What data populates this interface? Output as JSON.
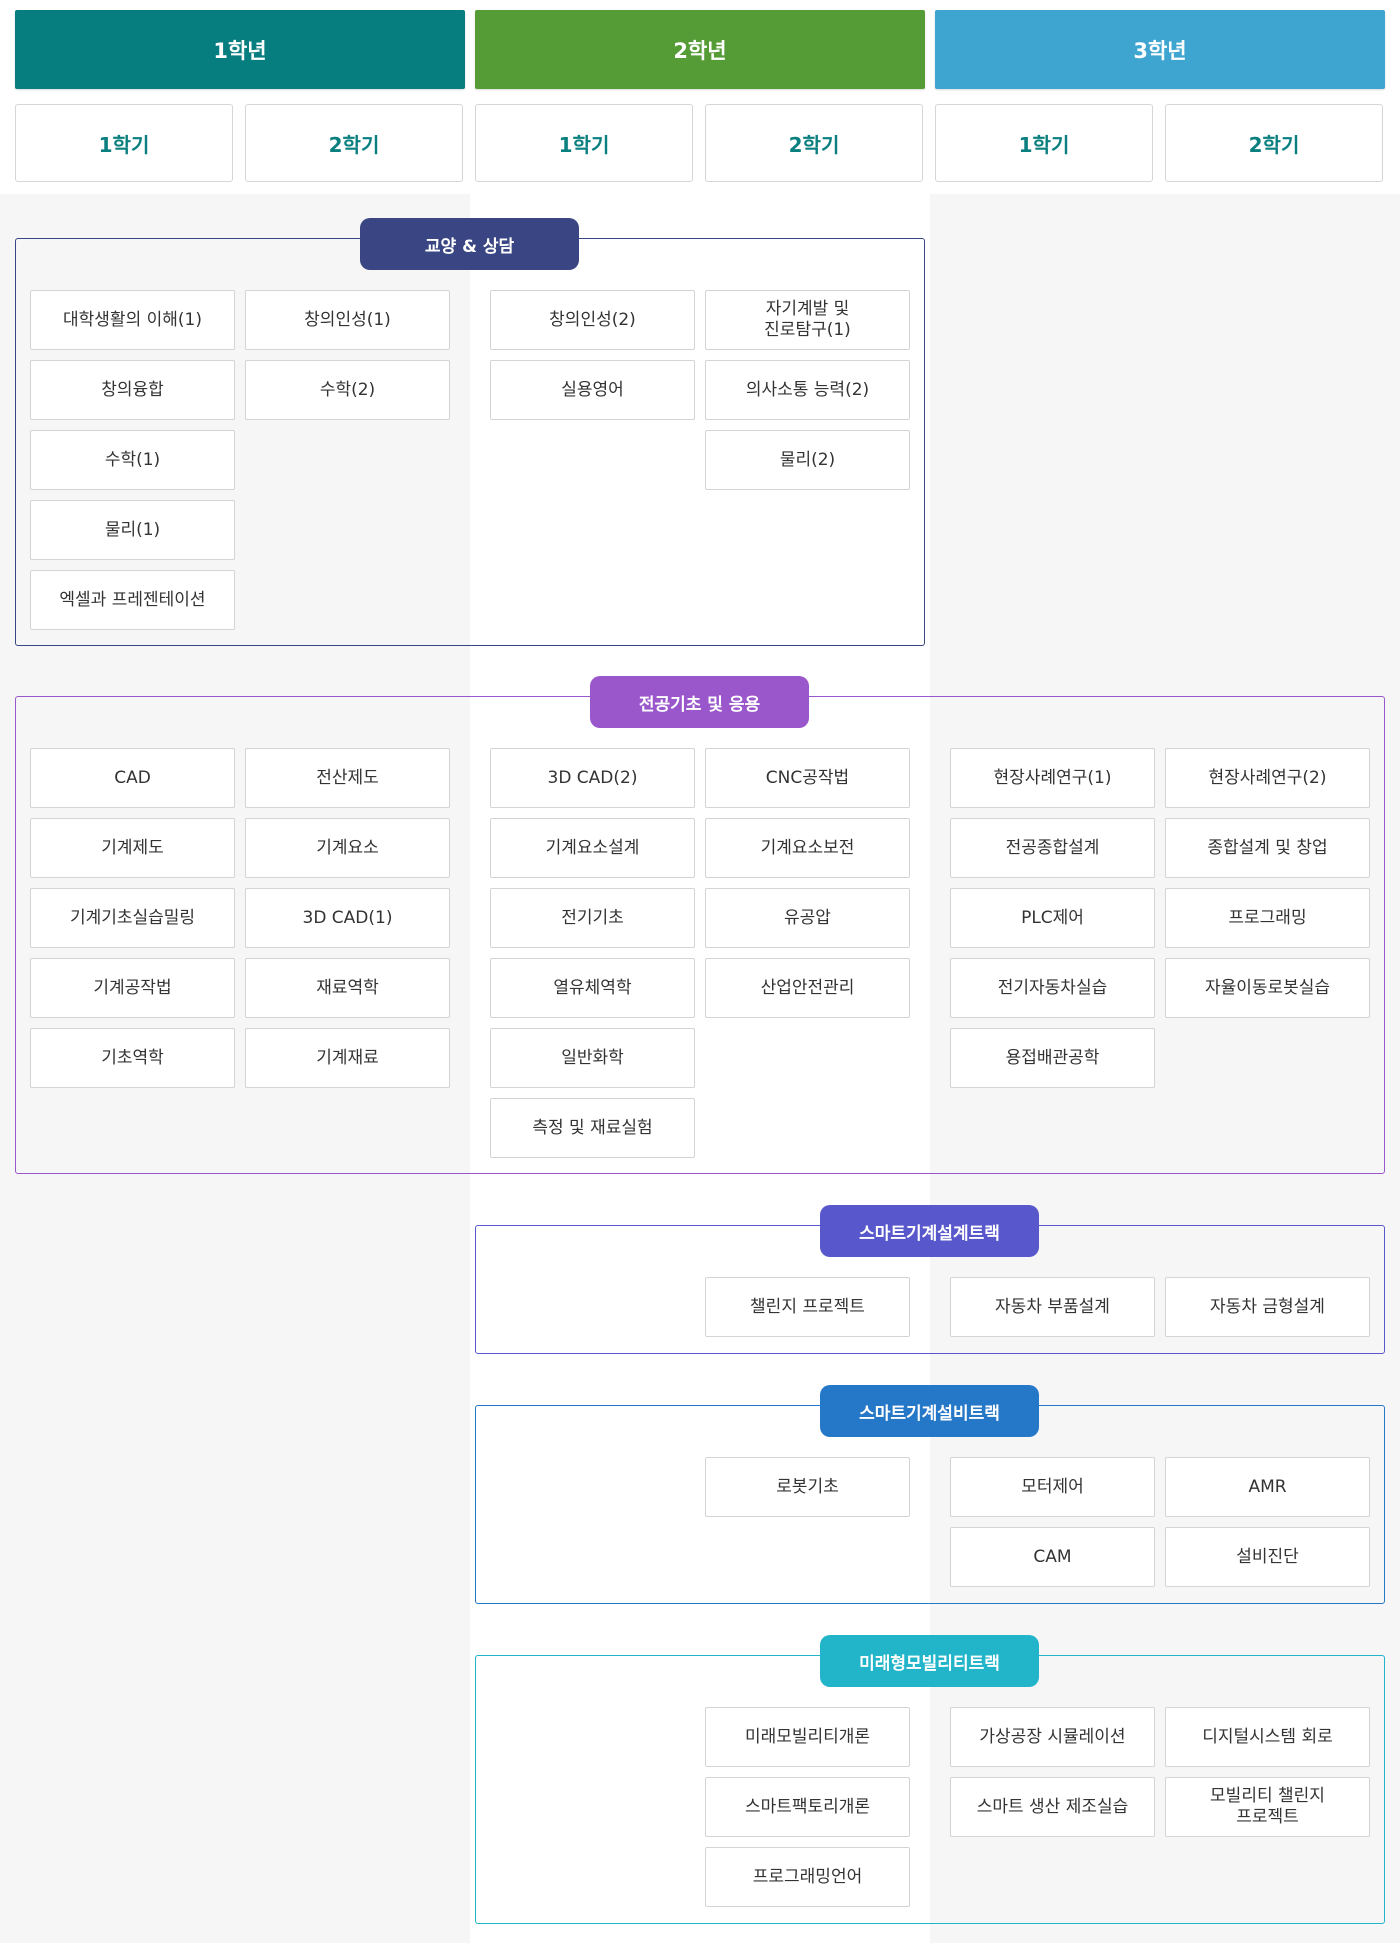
{
  "colors": {
    "year1": "#067e80",
    "year2": "#559c36",
    "year3": "#3ea5d0",
    "semester_text": "#0a7f80",
    "general": "#3a4683",
    "major": "#9a57cc",
    "design_track": "#5957cc",
    "equipment_track": "#2578c8",
    "mobility_track": "#22b4c9"
  },
  "years": [
    "1학년",
    "2학년",
    "3학년"
  ],
  "semesters": [
    "1학기",
    "2학기",
    "1학기",
    "2학기",
    "1학기",
    "2학기"
  ],
  "sections": {
    "general": {
      "title": "교양 & 상담",
      "courses": {
        "y1s1": [
          "대학생활의 이해(1)",
          "창의융합",
          "수학(1)",
          "물리(1)",
          "엑셀과 프레젠테이션"
        ],
        "y1s2": [
          "창의인성(1)",
          "수학(2)"
        ],
        "y2s1": [
          "창의인성(2)",
          "실용영어"
        ],
        "y2s2": [
          "자기계발 및\n진로탐구(1)",
          "의사소통 능력(2)",
          "물리(2)"
        ]
      }
    },
    "major": {
      "title": "전공기초 및 응용",
      "courses": {
        "y1s1": [
          "CAD",
          "기계제도",
          "기계기초실습밀링",
          "기계공작법",
          "기초역학"
        ],
        "y1s2": [
          "전산제도",
          "기계요소",
          "3D CAD(1)",
          "재료역학",
          "기계재료"
        ],
        "y2s1": [
          "3D CAD(2)",
          "기계요소설계",
          "전기기초",
          "열유체역학",
          "일반화학",
          "측정 및 재료실험"
        ],
        "y2s2": [
          "CNC공작법",
          "기계요소보전",
          "유공압",
          "산업안전관리"
        ],
        "y3s1": [
          "현장사례연구(1)",
          "전공종합설계",
          "PLC제어",
          "전기자동차실습",
          "용접배관공학"
        ],
        "y3s2": [
          "현장사례연구(2)",
          "종합설계 및 창업",
          "프로그래밍",
          "자율이동로봇실습"
        ]
      }
    },
    "design_track": {
      "title": "스마트기계설계트랙",
      "courses": {
        "y2s2": [
          "챌린지 프로젝트"
        ],
        "y3s1": [
          "자동차 부품설계"
        ],
        "y3s2": [
          "자동차 금형설계"
        ]
      }
    },
    "equipment_track": {
      "title": "스마트기계설비트랙",
      "courses": {
        "y2s2": [
          "로봇기초"
        ],
        "y3s1": [
          "모터제어",
          "CAM"
        ],
        "y3s2": [
          "AMR",
          "설비진단"
        ]
      }
    },
    "mobility_track": {
      "title": "미래형모빌리티트랙",
      "courses": {
        "y2s2": [
          "미래모빌리티개론",
          "스마트팩토리개론",
          "프로그래밍언어"
        ],
        "y3s1": [
          "가상공장 시뮬레이션",
          "스마트 생산 제조실습"
        ],
        "y3s2": [
          "디지털시스템 회로",
          "모빌리티 챌린지\n프로젝트"
        ]
      }
    }
  }
}
